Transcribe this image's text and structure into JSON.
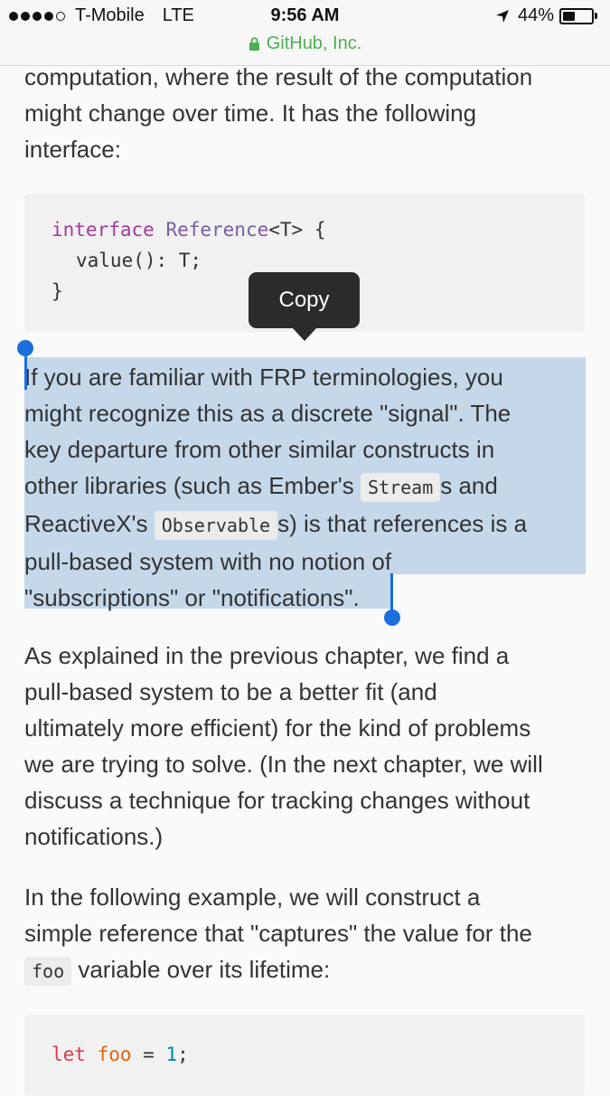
{
  "status_bar": {
    "carrier": "T-Mobile",
    "network": "LTE",
    "time": "9:56 AM",
    "battery": "44%",
    "battery_level": 0.44,
    "site": "GitHub, Inc."
  },
  "para1": [
    "computation, where the result of the computation",
    "might change over time. It has the following",
    "interface:"
  ],
  "code1": {
    "l1_kw": "interface",
    "l1_cls": "Reference",
    "l1_rest": "<T> {",
    "l2": "value(): T;",
    "l3": "}"
  },
  "tooltip": {
    "copy": "Copy"
  },
  "para2": {
    "l1": "If you are familiar with FRP terminologies, you",
    "l2": "might recognize this as a discrete \"signal\". The",
    "l3": "key departure from other similar constructs in",
    "l4_a": "other libraries (such as Ember's ",
    "l4_code": "Stream",
    "l4_b": "s and",
    "l5_a": "ReactiveX's ",
    "l5_code": "Observable",
    "l5_b": "s) is that references is a",
    "l6": "pull-based system with no notion of",
    "l7": "\"subscriptions\" or \"notifications\"."
  },
  "para3": [
    "As explained in the previous chapter, we find a",
    "pull-based system to be a better fit (and",
    "ultimately more efficient) for the kind of problems",
    "we are trying to solve. (In the next chapter, we will",
    "discuss a technique for tracking changes without",
    "notifications.)"
  ],
  "para4": {
    "l1": "In the following example, we will construct a",
    "l2": "simple reference that \"captures\" the value for the",
    "l3_code": "foo",
    "l3_b": " variable over its lifetime:"
  },
  "code2": {
    "kw": "let",
    "var": "foo",
    "eq": " = ",
    "num": "1",
    "end": ";"
  }
}
